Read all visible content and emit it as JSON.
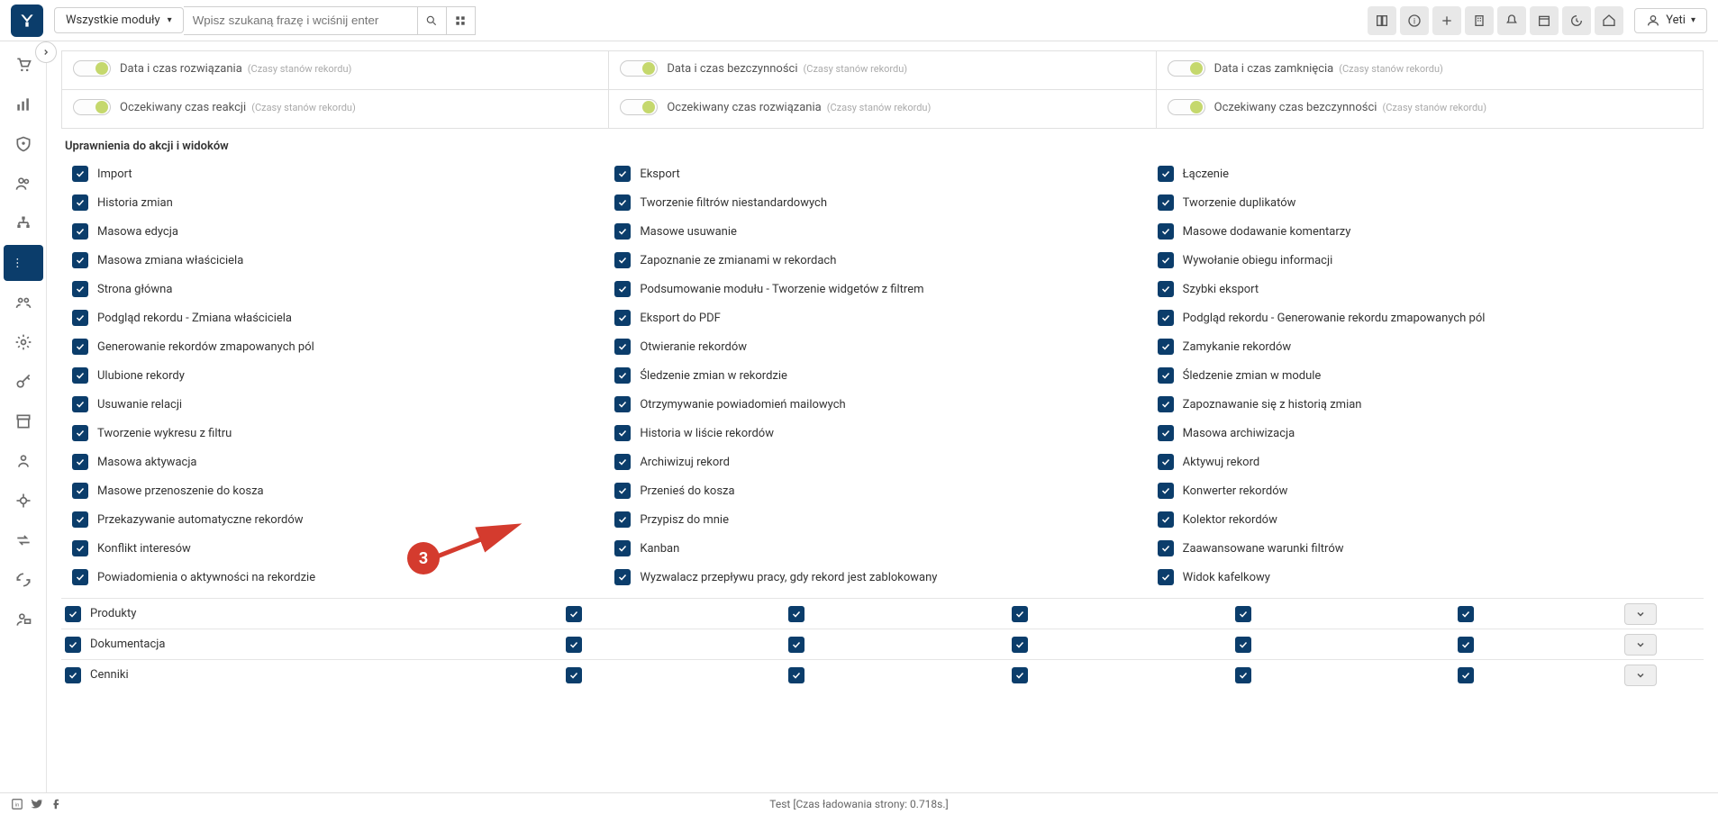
{
  "topbar": {
    "module_selector": "Wszystkie moduły",
    "search_placeholder": "Wpisz szukaną frazę i wciśnij enter",
    "user_name": "Yeti"
  },
  "record_states": {
    "rows": [
      [
        {
          "label": "Data i czas rozwiązania",
          "sub": "(Czasy stanów rekordu)"
        },
        {
          "label": "Data i czas bezczynności",
          "sub": "(Czasy stanów rekordu)"
        },
        {
          "label": "Data i czas zamknięcia",
          "sub": "(Czasy stanów rekordu)"
        }
      ],
      [
        {
          "label": "Oczekiwany czas reakcji",
          "sub": "(Czasy stanów rekordu)"
        },
        {
          "label": "Oczekiwany czas rozwiązania",
          "sub": "(Czasy stanów rekordu)"
        },
        {
          "label": "Oczekiwany czas bezczynności",
          "sub": "(Czasy stanów rekordu)"
        }
      ]
    ]
  },
  "permissions": {
    "title": "Uprawnienia do akcji i widoków",
    "items": [
      [
        "Import",
        "Eksport",
        "Łączenie"
      ],
      [
        "Historia zmian",
        "Tworzenie filtrów niestandardowych",
        "Tworzenie duplikatów"
      ],
      [
        "Masowa edycja",
        "Masowe usuwanie",
        "Masowe dodawanie komentarzy"
      ],
      [
        "Masowa zmiana właściciela",
        "Zapoznanie ze zmianami w rekordach",
        "Wywołanie obiegu informacji"
      ],
      [
        "Strona główna",
        "Podsumowanie modułu - Tworzenie widgetów z filtrem",
        "Szybki eksport"
      ],
      [
        "Podgląd rekordu - Zmiana właściciela",
        "Eksport do PDF",
        "Podgląd rekordu - Generowanie rekordu zmapowanych pól"
      ],
      [
        "Generowanie rekordów zmapowanych pól",
        "Otwieranie rekordów",
        "Zamykanie rekordów"
      ],
      [
        "Ulubione rekordy",
        "Śledzenie zmian w rekordzie",
        "Śledzenie zmian w module"
      ],
      [
        "Usuwanie relacji",
        "Otrzymywanie powiadomień mailowych",
        "Zapoznawanie się z historią zmian"
      ],
      [
        "Tworzenie wykresu z filtru",
        "Historia w liście rekordów",
        "Masowa archiwizacja"
      ],
      [
        "Masowa aktywacja",
        "Archiwizuj rekord",
        "Aktywuj rekord"
      ],
      [
        "Masowe przenoszenie do kosza",
        "Przenieś do kosza",
        "Konwerter rekordów"
      ],
      [
        "Przekazywanie automatyczne rekordów",
        "Przypisz do mnie",
        "Kolektor rekordów"
      ],
      [
        "Konflikt interesów",
        "Kanban",
        "Zaawansowane warunki filtrów"
      ],
      [
        "Powiadomienia o aktywności na rekordzie",
        "Wyzwalacz przepływu pracy, gdy rekord jest zablokowany",
        "Widok kafelkowy"
      ]
    ]
  },
  "modules": [
    {
      "name": "Produkty"
    },
    {
      "name": "Dokumentacja"
    },
    {
      "name": "Cenniki"
    }
  ],
  "footer": {
    "status": "Test [Czas ładowania strony: 0.718s.]"
  },
  "annotation": {
    "number": "3"
  }
}
